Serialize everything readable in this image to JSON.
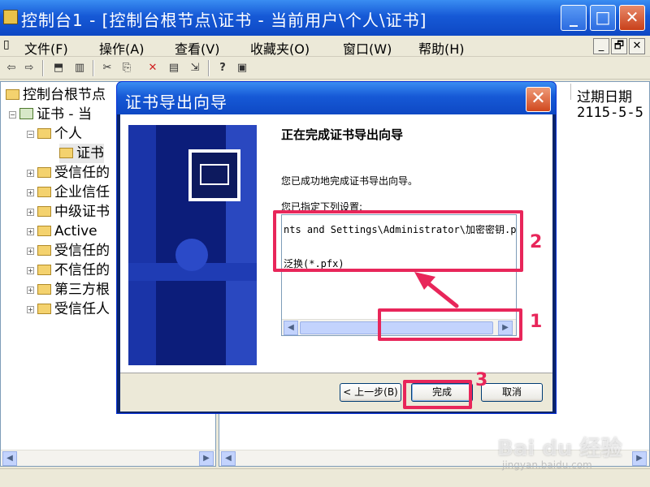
{
  "window": {
    "title": "控制台1 - [控制台根节点\\证书 - 当前用户\\个人\\证书]",
    "minimize": "_",
    "maximize": "□",
    "close": "✕"
  },
  "menu": {
    "items": [
      "文件(F)",
      "操作(A)",
      "查看(V)",
      "收藏夹(O)",
      "窗口(W)",
      "帮助(H)"
    ],
    "mdi": [
      "_",
      "🗗",
      "✕"
    ]
  },
  "toolbar": {
    "back": "⇦",
    "forward": "⇨",
    "up": "⬒",
    "show_hide_tree": "▥",
    "cut": "✂",
    "copy": "⎘",
    "delete": "✕",
    "properties": "▤",
    "export": "⇲",
    "help": "?",
    "new_window": "▣"
  },
  "tree": {
    "items": [
      {
        "label": "控制台根节点"
      },
      {
        "label": "证书 - 当"
      },
      {
        "label": "个人"
      },
      {
        "label": "证书"
      },
      {
        "label": "受信任的"
      },
      {
        "label": "企业信任"
      },
      {
        "label": "中级证书"
      },
      {
        "label": "Active"
      },
      {
        "label": "受信任的"
      },
      {
        "label": "不信任的"
      },
      {
        "label": "第三方根"
      },
      {
        "label": "受信任人"
      }
    ]
  },
  "list": {
    "column_expiry": "过期日期",
    "expiry_value": "2115-5-5"
  },
  "wizard": {
    "title": "证书导出向导",
    "close": "✕",
    "heading": "正在完成证书导出向导",
    "description": "您已成功地完成证书导出向导。",
    "specified_label": "您已指定下列设置:",
    "summary": {
      "line1": "nts and Settings\\Administrator\\加密密钥.pfx",
      "line2": "泛换(*.pfx)"
    },
    "buttons": {
      "back": "< 上一步(B)",
      "finish": "完成",
      "cancel": "取消"
    },
    "scroll_left": "◀",
    "scroll_right": "▶"
  },
  "annotations": {
    "marker1": "1",
    "marker2": "2",
    "marker3": "3",
    "accent_color": "#E8265A"
  },
  "watermark": {
    "brand": "Bai du 经验",
    "url": "jingyan.baidu.com"
  }
}
